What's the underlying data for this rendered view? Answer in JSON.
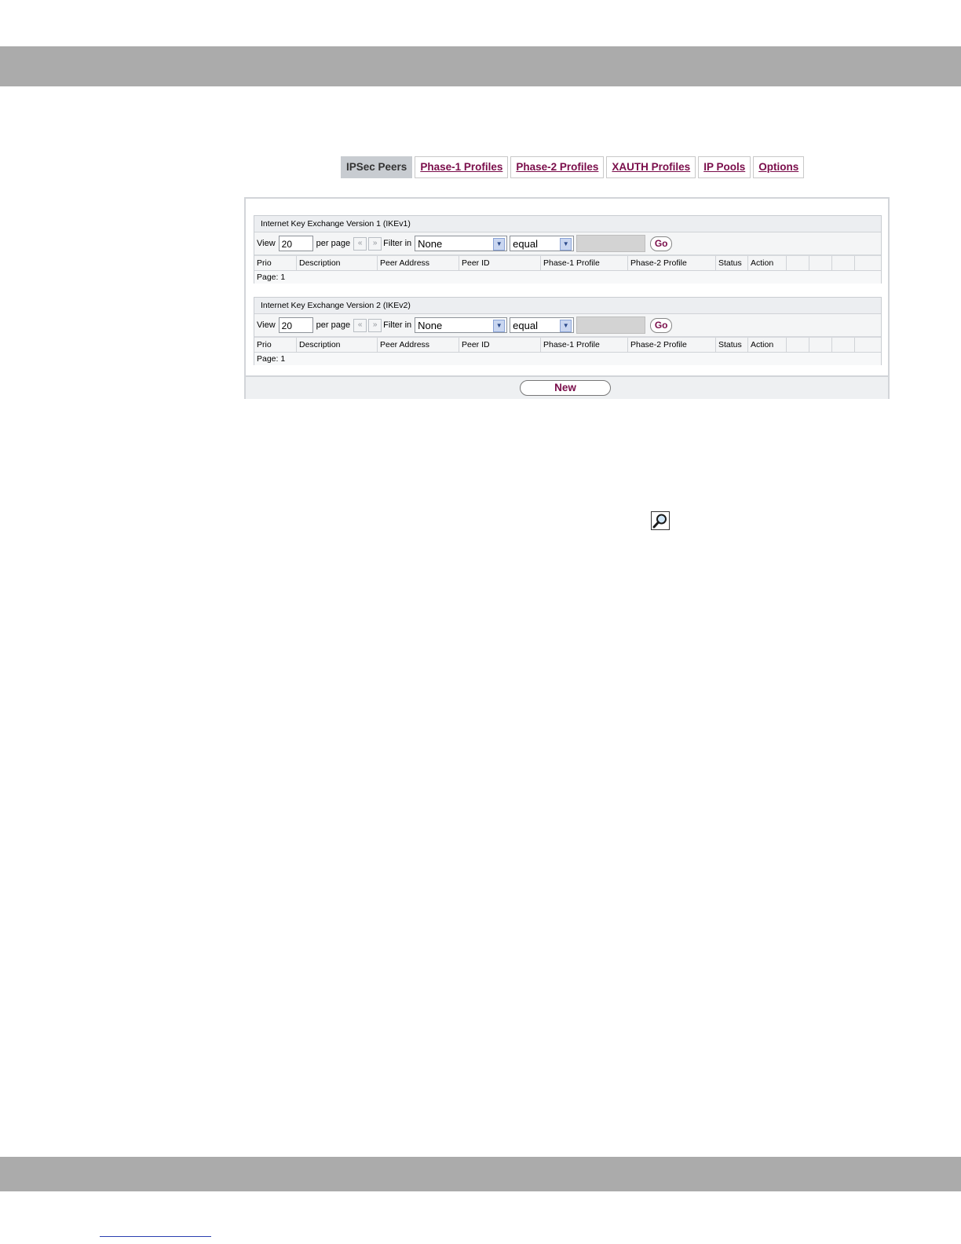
{
  "tabs": [
    {
      "label": "IPSec Peers",
      "active": true
    },
    {
      "label": "Phase-1 Profiles",
      "active": false
    },
    {
      "label": "Phase-2 Profiles",
      "active": false
    },
    {
      "label": "XAUTH Profiles",
      "active": false
    },
    {
      "label": "IP Pools",
      "active": false
    },
    {
      "label": "Options",
      "active": false
    }
  ],
  "ikev1": {
    "title": "Internet Key Exchange Version 1 (IKEv1)",
    "view_label": "View",
    "view_value": "20",
    "per_page_label": "per page",
    "prev_icon": "«",
    "next_icon": "»",
    "filter_label": "Filter in",
    "filter_value": "None",
    "operator_value": "equal",
    "go_label": "Go",
    "columns": [
      "Prio",
      "Description",
      "Peer Address",
      "Peer ID",
      "Phase-1 Profile",
      "Phase-2 Profile",
      "Status",
      "Action"
    ],
    "page_label": "Page:",
    "page_value": "1"
  },
  "ikev2": {
    "title": "Internet Key Exchange Version 2 (IKEv2)",
    "view_label": "View",
    "view_value": "20",
    "per_page_label": "per page",
    "prev_icon": "«",
    "next_icon": "»",
    "filter_label": "Filter in",
    "filter_value": "None",
    "operator_value": "equal",
    "go_label": "Go",
    "columns": [
      "Prio",
      "Description",
      "Peer Address",
      "Peer ID",
      "Phase-1 Profile",
      "Phase-2 Profile",
      "Status",
      "Action"
    ],
    "page_label": "Page:",
    "page_value": "1"
  },
  "new_button": "New",
  "icons": {
    "magnifier": "magnifier-icon",
    "dropdown": "chevron-down-icon"
  },
  "colors": {
    "band": "#ababab",
    "link": "#7a0d4a",
    "active_tab": "#c8ccd1",
    "panel_border": "#d2d5d9"
  }
}
